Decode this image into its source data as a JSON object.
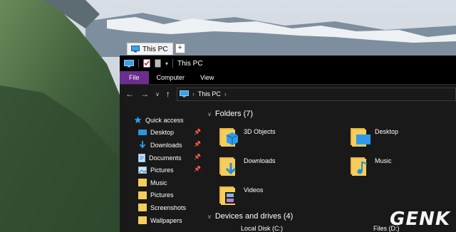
{
  "tab": {
    "title": "This PC",
    "new_tab": "+"
  },
  "titlebar": {
    "title": "This PC"
  },
  "ribbon": {
    "tabs": [
      "File",
      "Computer",
      "View"
    ]
  },
  "address": {
    "path": "This PC"
  },
  "sidebar": {
    "items": [
      {
        "label": "Quick access",
        "icon": "star-icon"
      },
      {
        "label": "Desktop",
        "icon": "desktop-folder-icon",
        "pinned": true
      },
      {
        "label": "Downloads",
        "icon": "download-arrow-icon",
        "pinned": true
      },
      {
        "label": "Documents",
        "icon": "document-icon",
        "pinned": true
      },
      {
        "label": "Pictures",
        "icon": "pictures-icon",
        "pinned": true
      },
      {
        "label": "Music",
        "icon": "folder-icon"
      },
      {
        "label": "Pictures",
        "icon": "folder-icon"
      },
      {
        "label": "Screenshots",
        "icon": "folder-icon"
      },
      {
        "label": "Wallpapers",
        "icon": "folder-icon"
      }
    ]
  },
  "folders": {
    "header": "Folders (7)",
    "items": [
      "3D Objects",
      "Desktop",
      "Downloads",
      "Music",
      "Videos"
    ]
  },
  "drives": {
    "header": "Devices and drives (4)",
    "items": [
      "Local Disk (C:)",
      "Files (D:)"
    ]
  },
  "watermark": "GENK",
  "colors": {
    "accent": "#6b2d8f",
    "window_bg": "#191919",
    "folder": "#f4cd5c",
    "blue": "#1e8fd9"
  }
}
